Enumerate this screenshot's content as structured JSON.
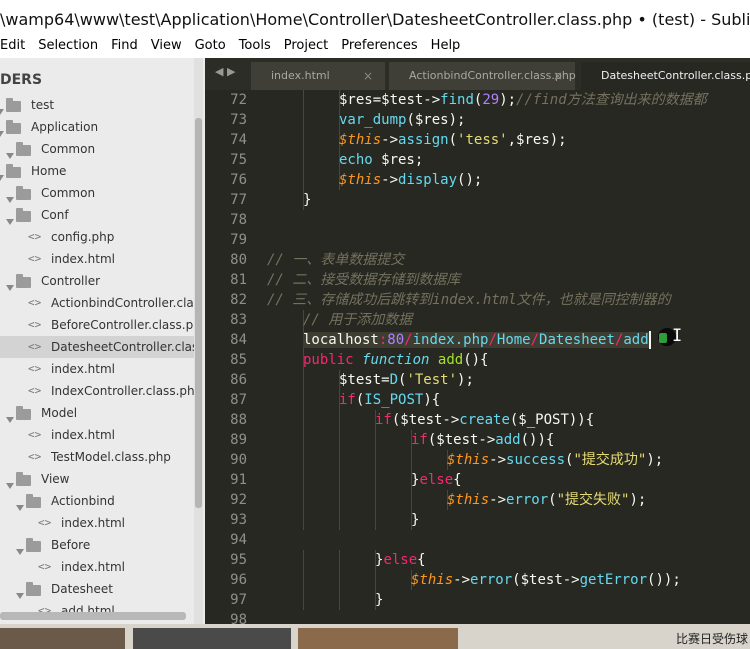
{
  "window": {
    "title": "\\wamp64\\www\\test\\Application\\Home\\Controller\\DatesheetController.class.php • (test) - Sublime Text"
  },
  "menu": [
    "Edit",
    "Selection",
    "Find",
    "View",
    "Goto",
    "Tools",
    "Project",
    "Preferences",
    "Help"
  ],
  "sidebar": {
    "header": "DERS",
    "items": [
      {
        "label": "test",
        "kind": "folder",
        "level": 0
      },
      {
        "label": "Application",
        "kind": "folder",
        "level": 0
      },
      {
        "label": "Common",
        "kind": "folder",
        "level": 1
      },
      {
        "label": "Home",
        "kind": "folder",
        "level": 0
      },
      {
        "label": "Common",
        "kind": "folder",
        "level": 1
      },
      {
        "label": "Conf",
        "kind": "folder",
        "level": 1
      },
      {
        "label": "config.php",
        "kind": "file",
        "level": 2
      },
      {
        "label": "index.html",
        "kind": "file",
        "level": 2
      },
      {
        "label": "Controller",
        "kind": "folder",
        "level": 1
      },
      {
        "label": "ActionbindController.class",
        "kind": "file",
        "level": 2
      },
      {
        "label": "BeforeController.class.php",
        "kind": "file",
        "level": 2
      },
      {
        "label": "DatesheetController.class.p",
        "kind": "file",
        "level": 2,
        "selected": true
      },
      {
        "label": "index.html",
        "kind": "file",
        "level": 2
      },
      {
        "label": "IndexController.class.php",
        "kind": "file",
        "level": 2
      },
      {
        "label": "Model",
        "kind": "folder",
        "level": 1
      },
      {
        "label": "index.html",
        "kind": "file",
        "level": 2
      },
      {
        "label": "TestModel.class.php",
        "kind": "file",
        "level": 2
      },
      {
        "label": "View",
        "kind": "folder",
        "level": 1
      },
      {
        "label": "Actionbind",
        "kind": "folder",
        "level": 2
      },
      {
        "label": "index.html",
        "kind": "file",
        "level": 3
      },
      {
        "label": "Before",
        "kind": "folder",
        "level": 2
      },
      {
        "label": "index.html",
        "kind": "file",
        "level": 3
      },
      {
        "label": "Datesheet",
        "kind": "folder",
        "level": 2
      },
      {
        "label": "add.html",
        "kind": "file",
        "level": 3
      }
    ],
    "file_glyph": "<>"
  },
  "tabs": [
    {
      "label": "index.html",
      "close": "×"
    },
    {
      "label": "ActionbindController.class.php",
      "close": "×"
    },
    {
      "label": "DatesheetController.class.php",
      "active": true
    }
  ],
  "tab_nav": "◀ ▶",
  "colors": {
    "keyword": "#f92672",
    "func": "#66d9ef",
    "string": "#e6db74",
    "number": "#ae81ff",
    "comment": "#75715e",
    "this": "#fd971f",
    "plain": "#f8f8f2"
  },
  "code": [
    {
      "n": "72",
      "indent": 3,
      "tokens": [
        [
          "p",
          "$res="
        ],
        [
          "p",
          "$test->"
        ],
        [
          "f",
          "find"
        ],
        [
          "p",
          "("
        ],
        [
          "n",
          "29"
        ],
        [
          "p",
          ");"
        ],
        [
          "c",
          "//find方法查询出来的数据都"
        ]
      ]
    },
    {
      "n": "73",
      "indent": 3,
      "tokens": [
        [
          "f",
          "var_dump"
        ],
        [
          "p",
          "($res);"
        ]
      ]
    },
    {
      "n": "74",
      "indent": 3,
      "tokens": [
        [
          "t",
          "$this"
        ],
        [
          "p",
          "->"
        ],
        [
          "f",
          "assign"
        ],
        [
          "p",
          "("
        ],
        [
          "s",
          "'tess'"
        ],
        [
          "p",
          ",$res);"
        ]
      ]
    },
    {
      "n": "75",
      "indent": 3,
      "tokens": [
        [
          "f",
          "echo"
        ],
        [
          "p",
          " $res;"
        ]
      ]
    },
    {
      "n": "76",
      "indent": 3,
      "tokens": [
        [
          "t",
          "$this"
        ],
        [
          "p",
          "->"
        ],
        [
          "f",
          "display"
        ],
        [
          "p",
          "();"
        ]
      ]
    },
    {
      "n": "77",
      "indent": 2,
      "tokens": [
        [
          "p",
          "}"
        ]
      ]
    },
    {
      "n": "78",
      "indent": 0,
      "tokens": []
    },
    {
      "n": "79",
      "indent": 0,
      "tokens": []
    },
    {
      "n": "80",
      "indent": 0,
      "tokens": [
        [
          "c",
          "// 一、表单数据提交"
        ]
      ]
    },
    {
      "n": "81",
      "indent": 0,
      "tokens": [
        [
          "c",
          "// 二、接受数据存储到数据库"
        ]
      ]
    },
    {
      "n": "82",
      "indent": 0,
      "tokens": [
        [
          "c",
          "// 三、存储成功后跳转到index.html文件，也就是同控制器的"
        ]
      ]
    },
    {
      "n": "83",
      "indent": 2,
      "tokens": [
        [
          "c",
          "// 用于添加数据"
        ]
      ]
    },
    {
      "n": "84",
      "indent": 2,
      "hl": true,
      "tokens": [
        [
          "p",
          "localhost"
        ],
        [
          "k",
          ":"
        ],
        [
          "n",
          "80"
        ],
        [
          "k",
          "/"
        ],
        [
          "f",
          "index.php"
        ],
        [
          "k",
          "/"
        ],
        [
          "f",
          "Home"
        ],
        [
          "k",
          "/"
        ],
        [
          "f",
          "Datesheet"
        ],
        [
          "k",
          "/"
        ],
        [
          "f",
          "add"
        ]
      ]
    },
    {
      "n": "85",
      "indent": 2,
      "tokens": [
        [
          "k",
          "public"
        ],
        [
          "p",
          " "
        ],
        [
          "fi",
          "function"
        ],
        [
          "p",
          " "
        ],
        [
          "g",
          "add"
        ],
        [
          "p",
          "(){"
        ]
      ]
    },
    {
      "n": "86",
      "indent": 3,
      "tokens": [
        [
          "p",
          "$test="
        ],
        [
          "f",
          "D"
        ],
        [
          "p",
          "("
        ],
        [
          "s",
          "'Test'"
        ],
        [
          "p",
          ");"
        ]
      ]
    },
    {
      "n": "87",
      "indent": 3,
      "tokens": [
        [
          "k",
          "if"
        ],
        [
          "p",
          "("
        ],
        [
          "f",
          "IS_POST"
        ],
        [
          "p",
          "){"
        ]
      ]
    },
    {
      "n": "88",
      "indent": 4,
      "tokens": [
        [
          "k",
          "if"
        ],
        [
          "p",
          "($test->"
        ],
        [
          "f",
          "create"
        ],
        [
          "p",
          "($_POST)){"
        ]
      ]
    },
    {
      "n": "89",
      "indent": 5,
      "tokens": [
        [
          "k",
          "if"
        ],
        [
          "p",
          "($test->"
        ],
        [
          "f",
          "add"
        ],
        [
          "p",
          "()){"
        ]
      ]
    },
    {
      "n": "90",
      "indent": 6,
      "tokens": [
        [
          "t",
          "$this"
        ],
        [
          "p",
          "->"
        ],
        [
          "f",
          "success"
        ],
        [
          "p",
          "("
        ],
        [
          "s",
          "\"提交成功\""
        ],
        [
          "p",
          ");"
        ]
      ]
    },
    {
      "n": "91",
      "indent": 5,
      "tokens": [
        [
          "p",
          "}"
        ],
        [
          "k",
          "else"
        ],
        [
          "p",
          "{"
        ]
      ]
    },
    {
      "n": "92",
      "indent": 6,
      "tokens": [
        [
          "t",
          "$this"
        ],
        [
          "p",
          "->"
        ],
        [
          "f",
          "error"
        ],
        [
          "p",
          "("
        ],
        [
          "s",
          "\"提交失败\""
        ],
        [
          "p",
          ");"
        ]
      ]
    },
    {
      "n": "93",
      "indent": 5,
      "tokens": [
        [
          "p",
          "}"
        ]
      ]
    },
    {
      "n": "94",
      "indent": 0,
      "tokens": []
    },
    {
      "n": "95",
      "indent": 4,
      "tokens": [
        [
          "p",
          "}"
        ],
        [
          "k",
          "else"
        ],
        [
          "p",
          "{"
        ]
      ]
    },
    {
      "n": "96",
      "indent": 5,
      "tokens": [
        [
          "t",
          "$this"
        ],
        [
          "p",
          "->"
        ],
        [
          "f",
          "error"
        ],
        [
          "p",
          "($test->"
        ],
        [
          "f",
          "getError"
        ],
        [
          "p",
          "());"
        ]
      ]
    },
    {
      "n": "97",
      "indent": 4,
      "tokens": [
        [
          "p",
          "}"
        ]
      ]
    },
    {
      "n": "98",
      "indent": 0,
      "tokens": []
    }
  ],
  "taskbar_text": "比赛日受伤球"
}
